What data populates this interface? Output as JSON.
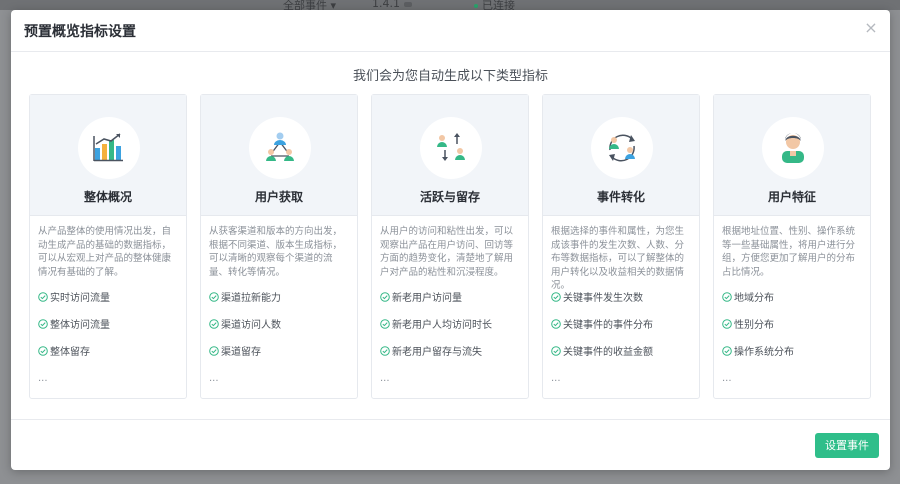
{
  "background": {
    "event_filter": "全部事件",
    "version": "1.4.1",
    "connection_status": "已连接"
  },
  "dialog": {
    "title": "预置概览指标设置",
    "close_label": "×",
    "subtitle": "我们会为您自动生成以下类型指标",
    "primary_button": "设置事件"
  },
  "colors": {
    "accent": "#2fbe8a",
    "check": "#35b887",
    "card_header_bg": "#f2f5f9"
  },
  "cards": [
    {
      "icon": "bar-chart-icon",
      "title": "整体概况",
      "description": "从产品整体的使用情况出发，自动生成产品的基础的数据指标，可以从宏观上对产品的整体健康情况有基础的了解。",
      "metrics": [
        "实时访问流量",
        "整体访问流量",
        "整体留存"
      ],
      "more": "..."
    },
    {
      "icon": "user-network-icon",
      "title": "用户获取",
      "description": "从获客渠道和版本的方向出发，根据不同渠道、版本生成指标，可以清晰的观察每个渠道的流量、转化等情况。",
      "metrics": [
        "渠道拉新能力",
        "渠道访问人数",
        "渠道留存"
      ],
      "more": "..."
    },
    {
      "icon": "user-exchange-icon",
      "title": "活跃与留存",
      "description": "从用户的访问和粘性出发，可以观察出产品在用户访问、回访等方面的趋势变化，清楚地了解用户对产品的粘性和沉浸程度。",
      "metrics": [
        "新老用户访问量",
        "新老用户人均访问时长",
        "新老用户留存与流失"
      ],
      "more": "..."
    },
    {
      "icon": "user-conversion-icon",
      "title": "事件转化",
      "description": "根据选择的事件和属性，为您生成该事件的发生次数、人数、分布等数据指标，可以了解整体的用户转化以及收益相关的数据情况。",
      "metrics": [
        "关键事件发生次数",
        "关键事件的事件分布",
        "关键事件的收益金额"
      ],
      "more": "..."
    },
    {
      "icon": "user-profile-icon",
      "title": "用户特征",
      "description": "根据地址位置、性别、操作系统等一些基础属性，将用户进行分组，方便您更加了解用户的分布占比情况。",
      "metrics": [
        "地域分布",
        "性别分布",
        "操作系统分布"
      ],
      "more": "..."
    }
  ]
}
